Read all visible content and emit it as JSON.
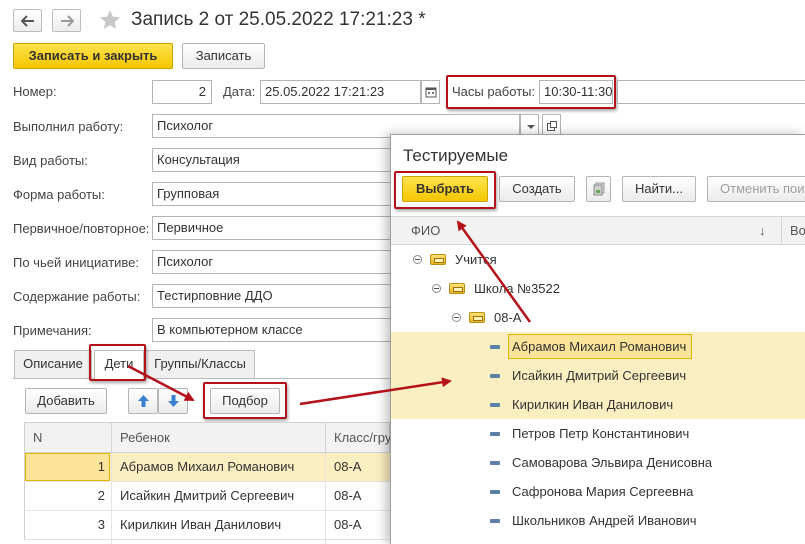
{
  "header": {
    "back_icon": "arrow-left-icon",
    "forward_icon": "arrow-right-icon",
    "favorite_icon": "star-icon",
    "title": "Запись 2 от 25.05.2022 17:21:23 *"
  },
  "toolbar": {
    "save_close_label": "Записать и закрыть",
    "save_label": "Записать"
  },
  "form": {
    "number_label": "Номер:",
    "number_value": "2",
    "date_label": "Дата:",
    "date_value": "25.05.2022 17:21:23",
    "hours_label": "Часы работы:",
    "hours_value": "10:30-11:30",
    "performer_label": "Выполнил работу:",
    "performer_value": "Психолог",
    "work_type_label": "Вид работы:",
    "work_type_value": "Консультация",
    "work_form_label": "Форма работы:",
    "work_form_value": "Групповая",
    "primary_label": "Первичное/повторное:",
    "primary_value": "Первичное",
    "initiative_label": "По чьей инициативе:",
    "initiative_value": "Психолог",
    "content_label": "Содержание работы:",
    "content_value": "Тестирповние ДДО",
    "notes_label": "Примечания:",
    "notes_value": "В компьютерном классе"
  },
  "tabs": [
    {
      "label": "Описание"
    },
    {
      "label": "Дети"
    },
    {
      "label": "Группы/Классы"
    }
  ],
  "children_toolbar": {
    "add_label": "Добавить",
    "pick_label": "Подбор"
  },
  "children_table": {
    "columns": [
      "N",
      "Ребенок",
      "Класс/гру"
    ],
    "rows": [
      {
        "n": "1",
        "name": "Абрамов Михаил Романович",
        "class": "08-А"
      },
      {
        "n": "2",
        "name": "Исайкин Дмитрий Сергеевич",
        "class": "08-А"
      },
      {
        "n": "3",
        "name": "Кирилкин Иван Данилович",
        "class": "08-А"
      }
    ]
  },
  "popup": {
    "title": "Тестируемые",
    "select_label": "Выбрать",
    "create_label": "Создать",
    "find_label": "Найти...",
    "cancel_search_label": "Отменить поис",
    "columns": [
      "ФИО",
      "↓",
      "Во"
    ],
    "tree": {
      "root": "Учится",
      "school": "Школа №3522",
      "class": "08-А",
      "people": [
        {
          "name": "Абрамов Михаил Романович",
          "selected": true
        },
        {
          "name": "Исайкин Дмитрий Сергеевич",
          "selected": true
        },
        {
          "name": "Кирилкин Иван Данилович",
          "selected": true
        },
        {
          "name": "Петров Петр Константинович",
          "selected": false
        },
        {
          "name": "Самоварова Эльвира Денисовна",
          "selected": false
        },
        {
          "name": "Сафронова Мария Сергеевна",
          "selected": false
        },
        {
          "name": "Школьников Андрей Иванович",
          "selected": false
        }
      ]
    }
  },
  "colors": {
    "accent_yellow": "#f5c600",
    "selection_row": "#fbeec1",
    "highlight_red": "#b4121b"
  }
}
